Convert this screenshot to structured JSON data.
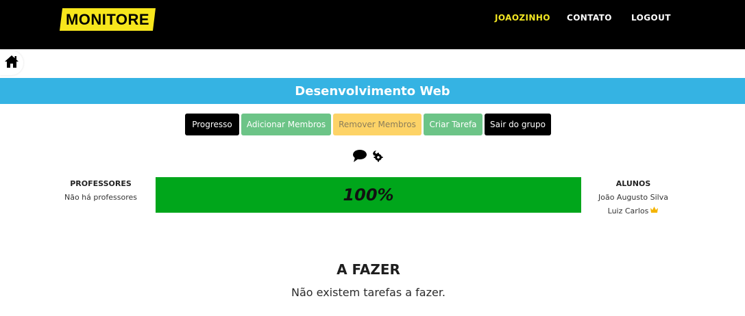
{
  "header": {
    "logo": "MONITORE",
    "nav": {
      "user": "JOAOZINHO",
      "contato": "CONTATO",
      "logout": "LOGOUT"
    },
    "colors": {
      "bar": "#000000",
      "logo_bg": "#f7e61c",
      "user_link": "#f2e622"
    }
  },
  "home": {
    "icon": "home-icon"
  },
  "group": {
    "title": "Desenvolvimento Web",
    "band_color": "#35b3e3"
  },
  "actions": {
    "progresso": "Progresso",
    "adicionar": "Adicionar Membros",
    "remover": "Remover Membros",
    "criar": "Criar Tarefa",
    "sair": "Sair do grupo"
  },
  "tools": {
    "chat_icon": "chat-bubble-icon",
    "settings_icon": "tools-icon"
  },
  "professores": {
    "title": "PROFESSORES",
    "empty": "Não há professores"
  },
  "progress": {
    "value": 1.0,
    "label": "100%",
    "color": "#00a61b"
  },
  "alunos": {
    "title": "ALUNOS",
    "members": [
      {
        "name": "João Augusto Silva",
        "owner": false
      },
      {
        "name": "Luiz Carlos",
        "owner": true
      }
    ],
    "owner_icon": "crown-icon"
  },
  "tasks": {
    "title": "A FAZER",
    "empty": "Não existem tarefas a fazer."
  }
}
